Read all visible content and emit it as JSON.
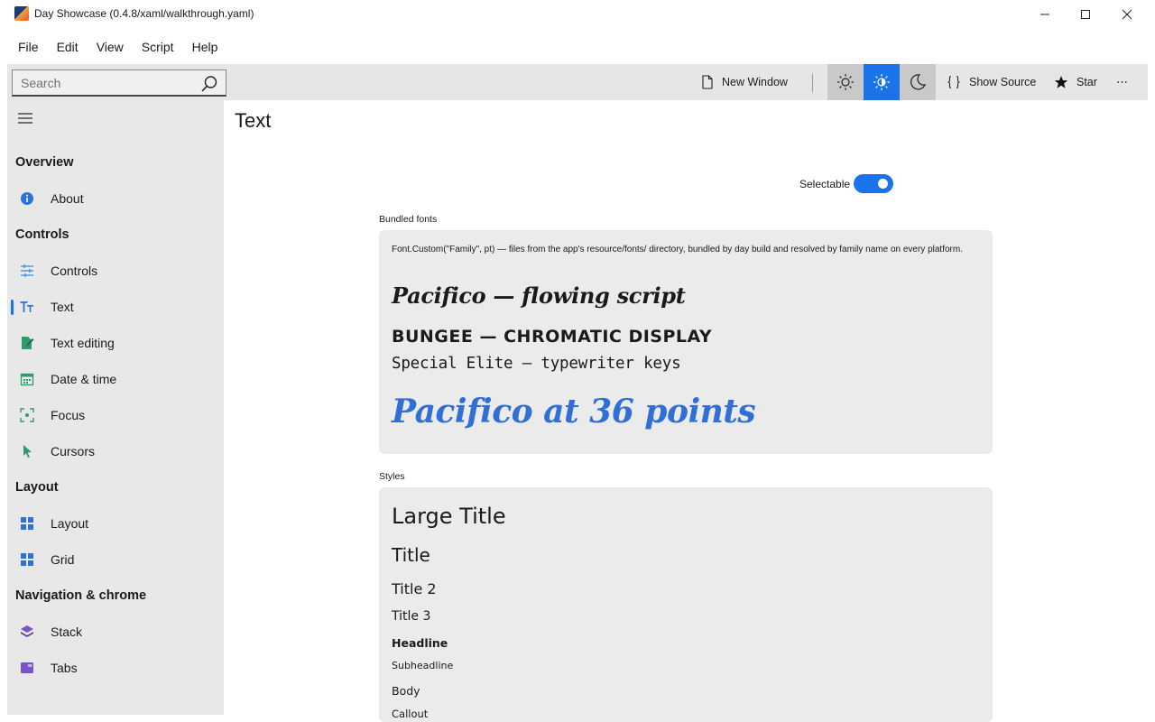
{
  "window": {
    "title": "Day Showcase (0.4.8/xaml/walkthrough.yaml)"
  },
  "menu": [
    "File",
    "Edit",
    "View",
    "Script",
    "Help"
  ],
  "toolbar": {
    "search_placeholder": "Search",
    "new_window_label": "New Window",
    "show_source_label": "Show Source",
    "star_label": "Star",
    "theme_active": "auto"
  },
  "sidebar": {
    "sections": [
      {
        "title": "Overview",
        "items": [
          {
            "label": "About",
            "icon": "info-icon"
          }
        ]
      },
      {
        "title": "Controls",
        "items": [
          {
            "label": "Controls",
            "icon": "sliders-icon"
          },
          {
            "label": "Text",
            "icon": "text-icon",
            "selected": true
          },
          {
            "label": "Text editing",
            "icon": "edit-document-icon"
          },
          {
            "label": "Date & time",
            "icon": "calendar-icon"
          },
          {
            "label": "Focus",
            "icon": "focus-icon"
          },
          {
            "label": "Cursors",
            "icon": "cursor-icon"
          }
        ]
      },
      {
        "title": "Layout",
        "items": [
          {
            "label": "Layout",
            "icon": "layout-grid-icon"
          },
          {
            "label": "Grid",
            "icon": "grid-icon"
          }
        ]
      },
      {
        "title": "Navigation & chrome",
        "items": [
          {
            "label": "Stack",
            "icon": "stack-icon"
          },
          {
            "label": "Tabs",
            "icon": "tabs-icon"
          }
        ]
      }
    ]
  },
  "main": {
    "page_title": "Text",
    "selectable_label": "Selectable",
    "selectable_on": true,
    "bundled": {
      "label": "Bundled fonts",
      "description": "Font.Custom(\"Family\", pt) — files from the app's resource/fonts/ directory, bundled by day build and resolved by family name on every platform.",
      "samples": {
        "pacifico": "Pacifico — flowing script",
        "bungee": "BUNGEE — CHROMATIC DISPLAY",
        "elite": "Special Elite — typewriter keys",
        "big": "Pacifico at 36 points"
      }
    },
    "styles": {
      "label": "Styles",
      "items": {
        "large_title": "Large Title",
        "title": "Title",
        "title2": "Title 2",
        "title3": "Title 3",
        "headline": "Headline",
        "subheadline": "Subheadline",
        "body": "Body",
        "callout": "Callout"
      }
    }
  },
  "colors": {
    "accent": "#1a73e8",
    "big_sample": "#2f6fd6",
    "sidebar_bg": "#e8e8e8",
    "card_bg": "#ebebeb"
  }
}
